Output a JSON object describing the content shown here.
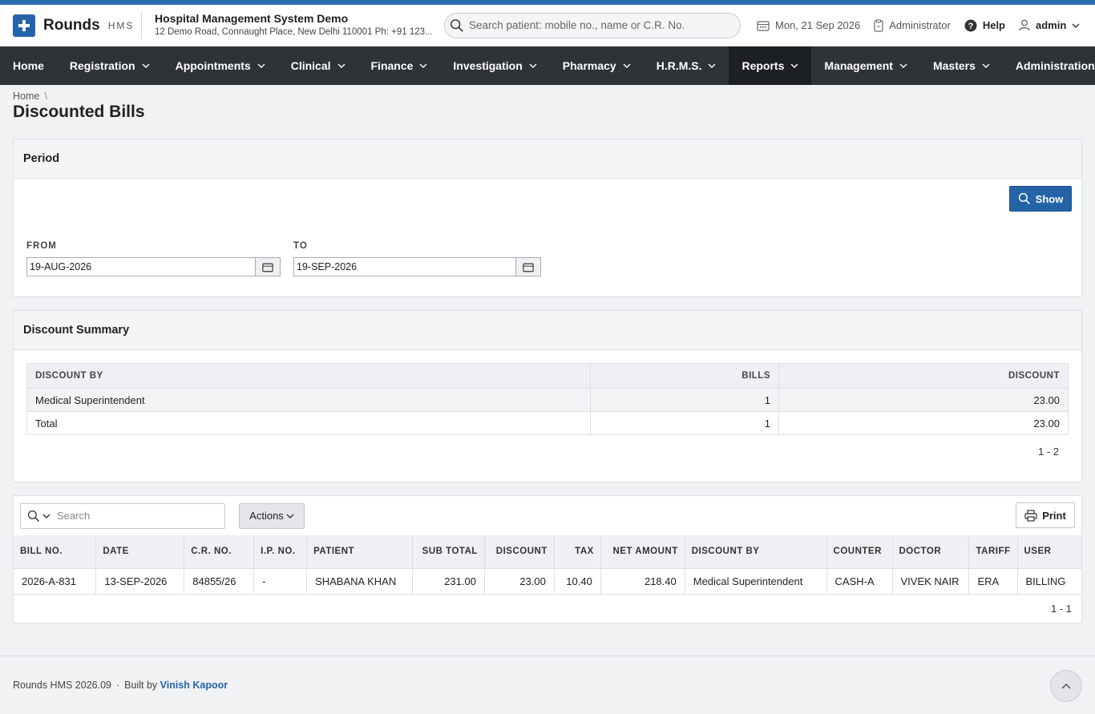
{
  "brand": {
    "name": "Rounds",
    "suffix": "HMS"
  },
  "hospital": {
    "name": "Hospital Management System Demo",
    "address": "12 Demo Road, Connaught Place, New Delhi 110001 Ph: +91 123..."
  },
  "search": {
    "placeholder": "Search patient: mobile no., name or C.R. No."
  },
  "header": {
    "date": "Mon, 21 Sep 2026",
    "role": "Administrator",
    "help": "Help",
    "user": "admin"
  },
  "nav": [
    {
      "label": "Home",
      "has_menu": false
    },
    {
      "label": "Registration",
      "has_menu": true
    },
    {
      "label": "Appointments",
      "has_menu": true
    },
    {
      "label": "Clinical",
      "has_menu": true
    },
    {
      "label": "Finance",
      "has_menu": true
    },
    {
      "label": "Investigation",
      "has_menu": true
    },
    {
      "label": "Pharmacy",
      "has_menu": true
    },
    {
      "label": "H.R.M.S.",
      "has_menu": true
    },
    {
      "label": "Reports",
      "has_menu": true,
      "active": true
    },
    {
      "label": "Management",
      "has_menu": true
    },
    {
      "label": "Masters",
      "has_menu": true
    },
    {
      "label": "Administration",
      "has_menu": true
    }
  ],
  "breadcrumb": {
    "home": "Home",
    "separator": "\\"
  },
  "page": {
    "title": "Discounted Bills"
  },
  "period": {
    "title": "Period",
    "show_label": "Show",
    "from_label": "FROM",
    "from_value": "19-AUG-2026",
    "to_label": "TO",
    "to_value": "19-SEP-2026"
  },
  "summary": {
    "title": "Discount Summary",
    "columns": [
      "DISCOUNT BY",
      "BILLS",
      "DISCOUNT"
    ],
    "rows": [
      [
        "Medical Superintendent",
        "1",
        "23.00"
      ],
      [
        "Total",
        "1",
        "23.00"
      ]
    ],
    "pager": "1 - 2"
  },
  "bills": {
    "search_placeholder": "Search",
    "actions_label": "Actions",
    "print_label": "Print",
    "columns": [
      "BILL NO.",
      "DATE",
      "C.R. NO.",
      "I.P. NO.",
      "PATIENT",
      "SUB TOTAL",
      "DISCOUNT",
      "TAX",
      "NET AMOUNT",
      "DISCOUNT BY",
      "COUNTER",
      "DOCTOR",
      "TARIFF",
      "USER"
    ],
    "rows": [
      [
        "2026-A-831",
        "13-SEP-2026",
        "84855/26",
        "-",
        "SHABANA KHAN",
        "231.00",
        "23.00",
        "10.40",
        "218.40",
        "Medical Superintendent",
        "CASH-A",
        "VIVEK NAIR",
        "ERA",
        "BILLING"
      ]
    ],
    "pager": "1 - 1"
  },
  "footer": {
    "product": "Rounds HMS 2026.09",
    "built_by": "Built by",
    "author": "Vinish Kapoor"
  },
  "colors": {
    "accent": "#2563a8",
    "nav_bg": "#2e3338",
    "nav_active": "#1c1f23"
  }
}
